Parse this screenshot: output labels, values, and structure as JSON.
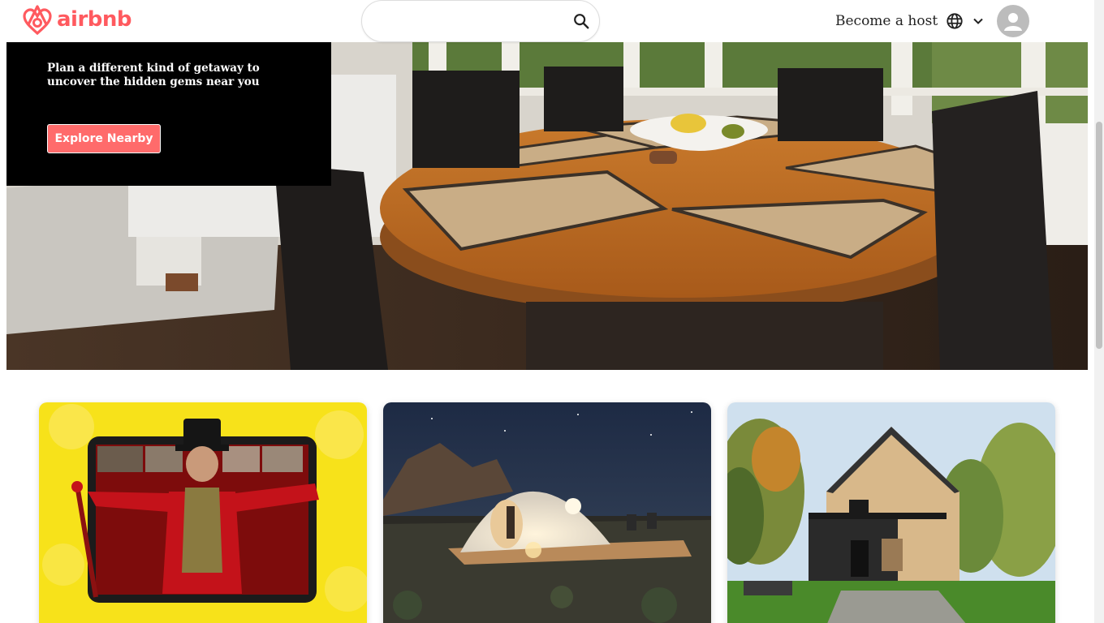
{
  "header": {
    "logo_text": "airbnb",
    "search": {
      "value": "",
      "placeholder": ""
    },
    "become_host_label": "Become a host",
    "icons": [
      "airbnb-logo-icon",
      "search-icon",
      "globe-icon",
      "chevron-down-icon",
      "user-avatar-icon"
    ]
  },
  "hero": {
    "subtitle": "Plan a different kind of getaway to uncover the hidden gems near you",
    "explore_button_label": "Explore Nearby"
  },
  "cards": [
    {
      "image": "online-experience-ringmaster"
    },
    {
      "image": "geodesic-dome-night"
    },
    {
      "image": "a-frame-cabin"
    }
  ],
  "colors": {
    "brand": "#ff5a5f",
    "button": "#ff6b6b",
    "panel": "#000000"
  }
}
